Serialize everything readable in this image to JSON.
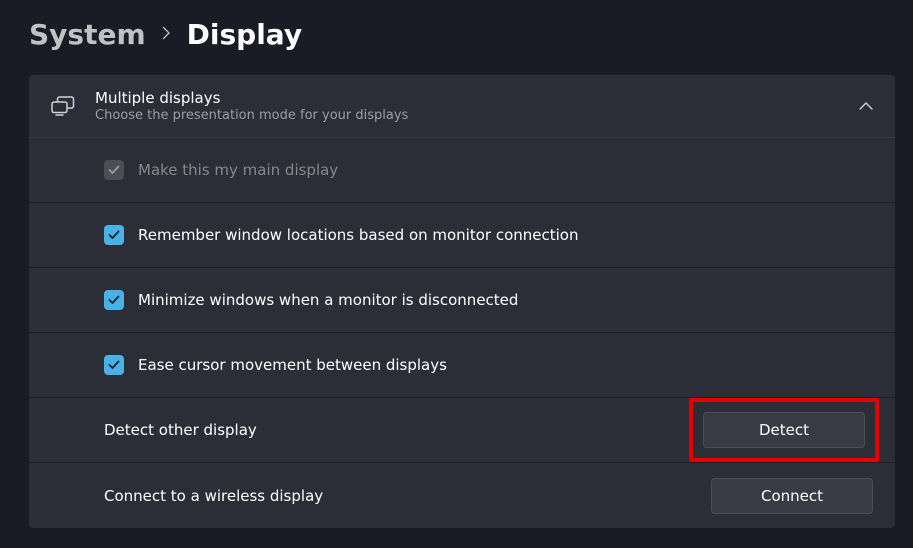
{
  "breadcrumb": {
    "parent": "System",
    "current": "Display"
  },
  "section": {
    "title": "Multiple displays",
    "subtitle": "Choose the presentation mode for your displays",
    "icon": "multiple-displays-icon"
  },
  "options": {
    "main_display": {
      "label": "Make this my main display",
      "checked": true,
      "enabled": false
    },
    "remember_windows": {
      "label": "Remember window locations based on monitor connection",
      "checked": true,
      "enabled": true
    },
    "minimize_disconnect": {
      "label": "Minimize windows when a monitor is disconnected",
      "checked": true,
      "enabled": true
    },
    "ease_cursor": {
      "label": "Ease cursor movement between displays",
      "checked": true,
      "enabled": true
    }
  },
  "actions": {
    "detect": {
      "label": "Detect other display",
      "button": "Detect"
    },
    "connect": {
      "label": "Connect to a wireless display",
      "button": "Connect"
    }
  }
}
